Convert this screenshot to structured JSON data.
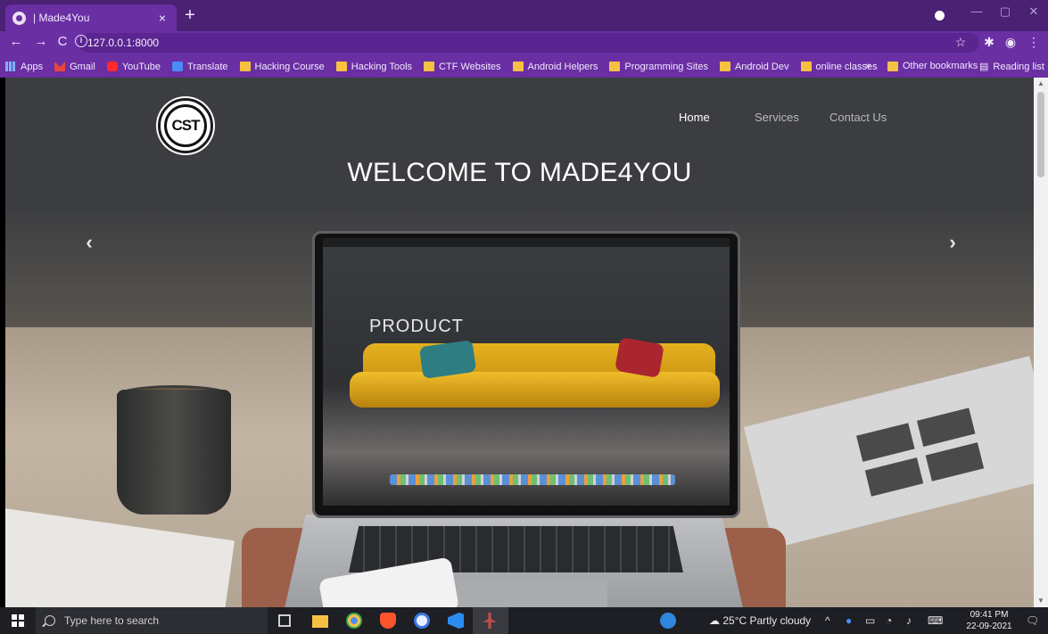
{
  "browser": {
    "tab_title": "| Made4You",
    "tab_close": "×",
    "new_tab": "+",
    "url": "127.0.0.1:8000",
    "url_info": "i"
  },
  "bookmarks": [
    {
      "label": "Apps",
      "icon": "apps-grid-icon"
    },
    {
      "label": "Gmail",
      "icon": "gmail-icon"
    },
    {
      "label": "YouTube",
      "icon": "youtube-icon"
    },
    {
      "label": "Translate",
      "icon": "translate-icon"
    },
    {
      "label": "Hacking Course",
      "icon": "folder-icon"
    },
    {
      "label": "Hacking Tools",
      "icon": "folder-icon"
    },
    {
      "label": "CTF Websites",
      "icon": "folder-icon"
    },
    {
      "label": "Android Helpers",
      "icon": "folder-icon"
    },
    {
      "label": "Programming Sites",
      "icon": "folder-icon"
    },
    {
      "label": "Android Dev",
      "icon": "folder-icon"
    },
    {
      "label": "online classes",
      "icon": "folder-icon"
    }
  ],
  "bookmarks_right": {
    "overflow": "»",
    "other": "Other bookmarks",
    "reading": "Reading list"
  },
  "site": {
    "logo_text": "CST",
    "nav": [
      {
        "label": "Home",
        "active": true
      },
      {
        "label": "Services",
        "active": false
      },
      {
        "label": "Contact Us",
        "active": false
      }
    ],
    "welcome": "WELCOME TO MADE4YOU",
    "carousel_prev": "‹",
    "carousel_next": "›",
    "hero_screen_title": "PRODUCT"
  },
  "taskbar": {
    "search_placeholder": "Type here to search",
    "weather": "25°C  Partly cloudy",
    "time": "09:41 PM",
    "date": "22-09-2021",
    "tray_chevron": "^"
  }
}
